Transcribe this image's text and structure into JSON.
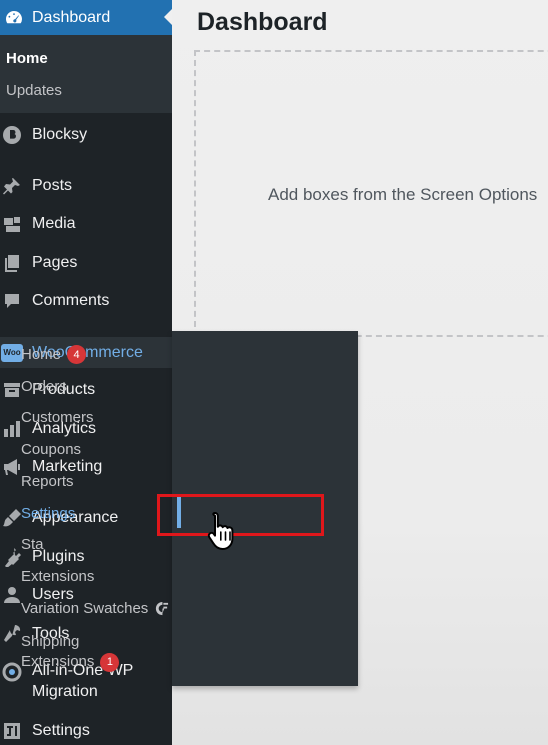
{
  "sidebar": {
    "dashboard": {
      "label": "Dashboard",
      "icon": "dashboard-icon"
    },
    "dashboard_sub": {
      "home": "Home",
      "updates": "Updates"
    },
    "items": [
      {
        "label": "Blocksy",
        "icon": "blocksy-icon"
      },
      {
        "label": "Posts",
        "icon": "pin-icon"
      },
      {
        "label": "Media",
        "icon": "media-icon"
      },
      {
        "label": "Pages",
        "icon": "pages-icon"
      },
      {
        "label": "Comments",
        "icon": "comment-icon"
      },
      {
        "label": "WooCommerce",
        "icon": "woocommerce-icon",
        "badge_text": "Woo"
      },
      {
        "label": "Products",
        "icon": "archive-icon"
      },
      {
        "label": "Analytics",
        "icon": "bar-chart-icon"
      },
      {
        "label": "Marketing",
        "icon": "megaphone-icon"
      },
      {
        "label": "Appearance",
        "icon": "paintbrush-icon"
      },
      {
        "label": "Plugins",
        "icon": "plug-icon"
      },
      {
        "label": "Users",
        "icon": "user-icon"
      },
      {
        "label": "Tools",
        "icon": "wrench-icon"
      },
      {
        "label": "All-in-One WP Migration",
        "icon": "migration-icon"
      },
      {
        "label": "Settings",
        "icon": "settings-icon"
      }
    ]
  },
  "main": {
    "title": "Dashboard",
    "dropzone_text": "Add boxes from the Screen Options"
  },
  "woo_flyout": {
    "items": [
      {
        "label": "Home",
        "badge": "4"
      },
      {
        "label": "Orders"
      },
      {
        "label": "Customers"
      },
      {
        "label": "Coupons"
      },
      {
        "label": "Reports"
      },
      {
        "label": "Settings",
        "current": true
      },
      {
        "label": "Sta"
      },
      {
        "label": "Extensions"
      },
      {
        "label": "Variation Swatches",
        "icon": "cf-logo-icon"
      },
      {
        "label_line1": "Shipping",
        "label_line2": "Extensions",
        "badge": "1"
      }
    ]
  },
  "colors": {
    "sidebar_bg": "#1e2327",
    "accent_blue": "#2271b1",
    "active_text": "#72aee6",
    "badge_red": "#d63638",
    "highlight_red": "#e0171b"
  }
}
